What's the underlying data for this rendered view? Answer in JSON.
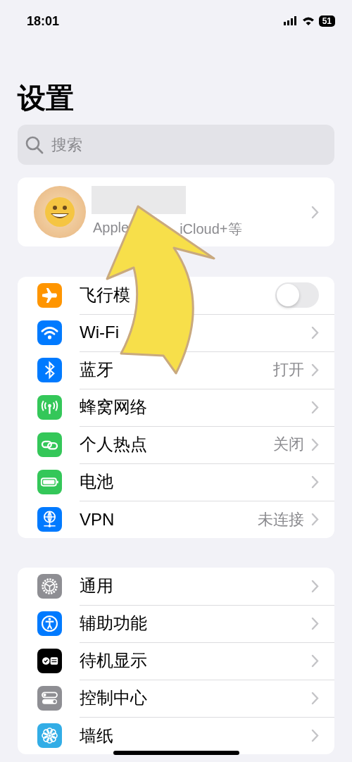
{
  "status_bar": {
    "time": "18:01",
    "battery": "51"
  },
  "title": "设置",
  "search": {
    "placeholder": "搜索"
  },
  "account": {
    "subtitle_parts": [
      "Apple",
      "iCloud+等"
    ]
  },
  "groups": [
    {
      "rows": [
        {
          "kind": "toggle",
          "label": "飞行模",
          "color": "#ff9500",
          "on": false
        },
        {
          "kind": "link",
          "label": "Wi-Fi",
          "color": "#007aff"
        },
        {
          "kind": "link",
          "label": "蓝牙",
          "color": "#007aff",
          "detail": "打开"
        },
        {
          "kind": "link",
          "label": "蜂窝网络",
          "color": "#34c759"
        },
        {
          "kind": "link",
          "label": "个人热点",
          "color": "#34c759",
          "detail": "关闭"
        },
        {
          "kind": "link",
          "label": "电池",
          "color": "#34c759"
        },
        {
          "kind": "link",
          "label": "VPN",
          "color": "#007aff",
          "detail": "未连接"
        }
      ]
    },
    {
      "rows": [
        {
          "kind": "link",
          "label": "通用",
          "color": "#8e8e93"
        },
        {
          "kind": "link",
          "label": "辅助功能",
          "color": "#007aff"
        },
        {
          "kind": "link",
          "label": "待机显示",
          "color": "#000000"
        },
        {
          "kind": "link",
          "label": "控制中心",
          "color": "#8e8e93"
        },
        {
          "kind": "link",
          "label": "墙纸",
          "color": "#32ade6"
        }
      ]
    }
  ]
}
